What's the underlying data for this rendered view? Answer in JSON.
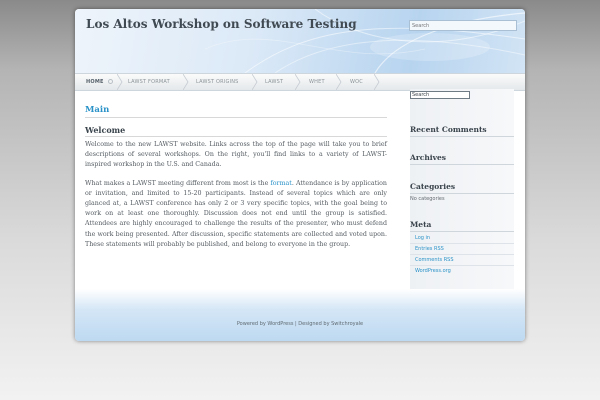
{
  "site": {
    "title": "Los Altos Workshop on Software Testing"
  },
  "header": {
    "search_placeholder": "Search"
  },
  "nav": {
    "items": [
      "HOME",
      "LAWST FORMAT",
      "LAWST ORIGINS",
      "LAWST",
      "WHET",
      "WOC"
    ]
  },
  "content": {
    "section_title": "Main",
    "post_title": "Welcome",
    "para1": "Welcome to the new LAWST website. Links across the top of the page will take you to brief descriptions of several workshops. On the right, you'll find links to a variety of LAWST-inspired workshop in the U.S. and Canada.",
    "para2_before": "What makes a LAWST meeting different from most is the ",
    "para2_link": "format",
    "para2_after": ". Attendance is by application or invitation, and limited to 15-20 participants. Instead of several topics which are only glanced at, a LAWST conference has only 2 or 3 very specific topics, with the goal being to work on at least one thoroughly. Discussion does not end until the group is satisfied. Attendees are highly encouraged to challenge the results of the presenter, who must defend the work being presented. After discussion, specific statements are collected and voted upon. These statements will probably be published, and belong to everyone in the group."
  },
  "sidebar": {
    "search_value": "Search",
    "recent_comments": "Recent Comments",
    "archives": "Archives",
    "categories": "Categories",
    "no_categories": "No categories",
    "meta": "Meta",
    "meta_links": [
      "Log in",
      "Entries RSS",
      "Comments RSS",
      "WordPress.org"
    ]
  },
  "footer": {
    "text": "Powered by WordPress | Designed by Switchroyale"
  },
  "colors": {
    "accent": "#2a92c8",
    "heading": "#3a444c"
  }
}
